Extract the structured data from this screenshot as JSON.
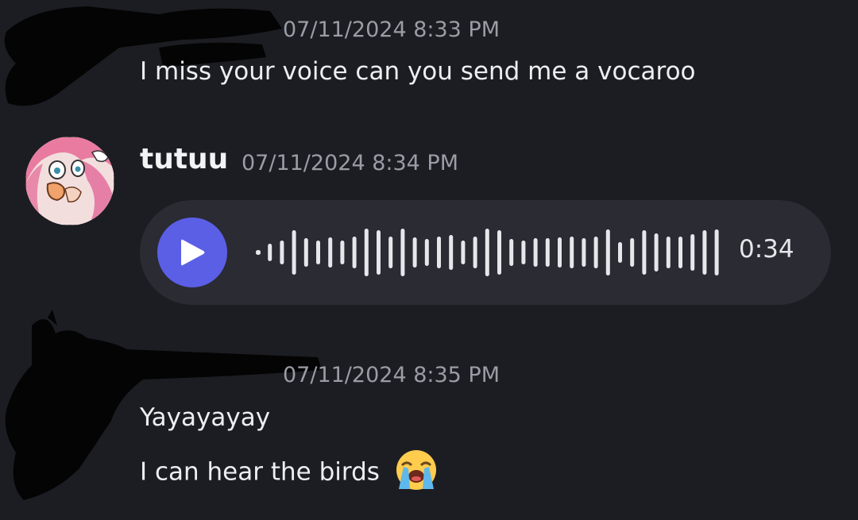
{
  "messages": [
    {
      "timestamp": "07/11/2024 8:33 PM",
      "lines": [
        "I miss your voice can you send me a vocaroo"
      ]
    },
    {
      "username": "tutuu",
      "timestamp": "07/11/2024 8:34 PM",
      "attachment": {
        "type": "voice-message",
        "duration": "0:34",
        "play_icon": "play-icon"
      }
    },
    {
      "timestamp": "07/11/2024 8:35 PM",
      "lines": [
        "Yayayayay",
        "I can hear the birds"
      ],
      "emoji": "loudly-crying-face-emoji"
    }
  ],
  "colors": {
    "background": "#1c1d22",
    "voice_bubble": "#2a2b33",
    "play_button": "#5b5fe6",
    "timestamp": "#9a9ca6"
  }
}
